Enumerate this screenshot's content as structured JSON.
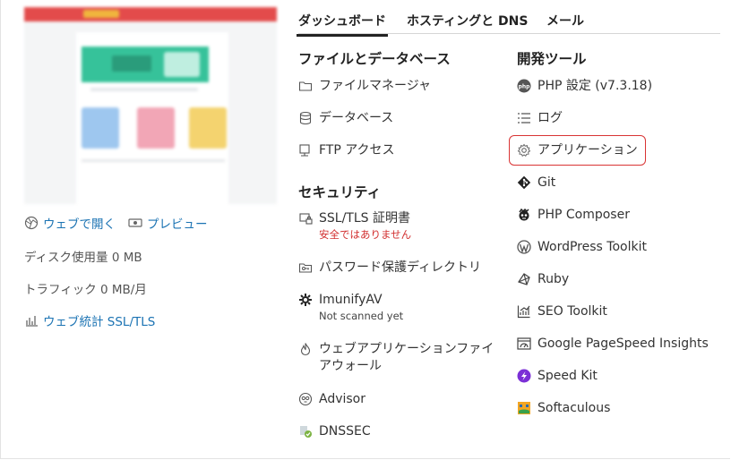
{
  "tabs": [
    {
      "label": "ダッシュボード",
      "active": true
    },
    {
      "label": "ホスティングと DNS",
      "active": false
    },
    {
      "label": "メール",
      "active": false
    }
  ],
  "site": {
    "open_web": "ウェブで開く",
    "preview": "プレビュー",
    "disk_usage": "ディスク使用量 0 MB",
    "traffic": "トラフィック 0 MB/月",
    "web_stats": "ウェブ統計 SSL/TLS"
  },
  "files_db": {
    "heading": "ファイルとデータベース",
    "items": [
      "ファイルマネージャ",
      "データベース",
      "FTP アクセス"
    ]
  },
  "security": {
    "heading": "セキュリティ",
    "ssl": {
      "label": "SSL/TLS 証明書",
      "status": "安全ではありません"
    },
    "password_dirs": "パスワード保護ディレクトリ",
    "imunify": {
      "label": "ImunifyAV",
      "status": "Not scanned yet"
    },
    "waf": {
      "line1": "ウェブアプリケーションファイ",
      "line2": "アウォール"
    },
    "advisor": "Advisor",
    "dnssec": "DNSSEC"
  },
  "dev_tools": {
    "heading": "開発ツール",
    "items": [
      {
        "label": "PHP 設定 (v7.3.18)",
        "icon": "php-icon"
      },
      {
        "label": "ログ",
        "icon": "log-icon"
      },
      {
        "label": "アプリケーション",
        "icon": "gear-icon",
        "highlighted": true
      },
      {
        "label": "Git",
        "icon": "git-icon"
      },
      {
        "label": "PHP Composer",
        "icon": "composer-icon"
      },
      {
        "label": "WordPress Toolkit",
        "icon": "wordpress-icon"
      },
      {
        "label": "Ruby",
        "icon": "ruby-icon"
      },
      {
        "label": "SEO Toolkit",
        "icon": "seo-chart-icon"
      },
      {
        "label": "Google PageSpeed Insights",
        "icon": "pagespeed-icon"
      },
      {
        "label": "Speed Kit",
        "icon": "speed-kit-icon"
      },
      {
        "label": "Softaculous",
        "icon": "softaculous-icon"
      }
    ]
  },
  "colors": {
    "link": "#1b73b3",
    "warning": "#d22f2f",
    "highlight_border": "#d93434"
  }
}
